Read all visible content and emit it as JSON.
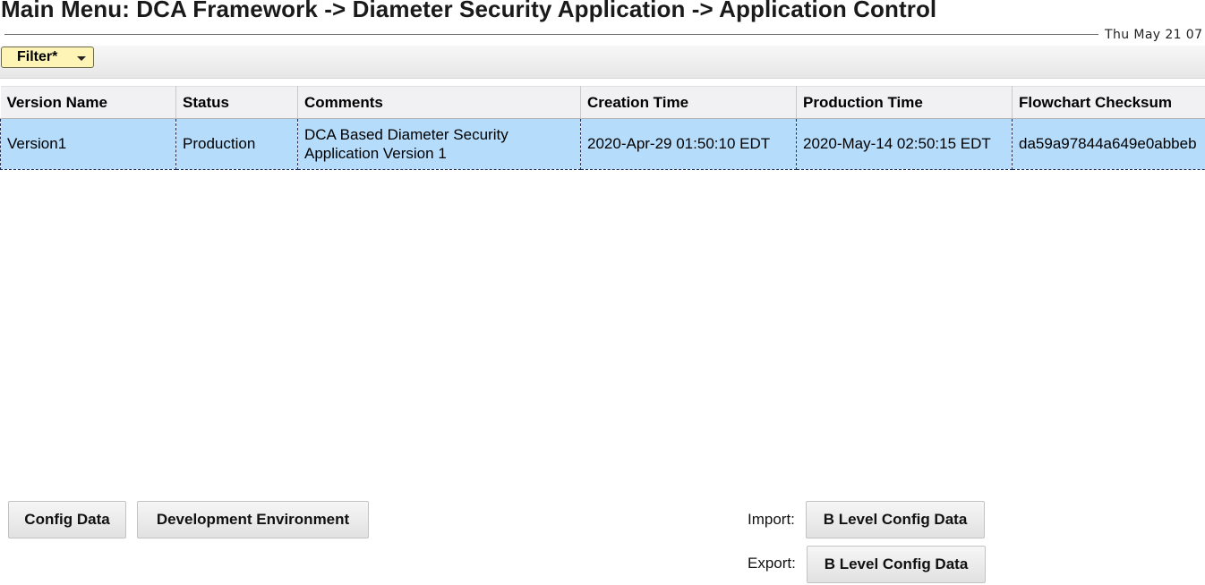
{
  "header": {
    "title": "Main Menu: DCA Framework -> Diameter Security Application -> Application Control",
    "datetime": "Thu May 21 07"
  },
  "filter": {
    "label": "Filter*"
  },
  "table": {
    "columns": [
      "Version Name",
      "Status",
      "Comments",
      "Creation Time",
      "Production Time",
      "Flowchart Checksum"
    ],
    "rows": [
      {
        "version_name": "Version1",
        "status": "Production",
        "comments": "DCA Based Diameter Security Application Version 1",
        "creation_time": "2020-Apr-29 01:50:10 EDT",
        "production_time": "2020-May-14 02:50:15 EDT",
        "flowchart_checksum": "da59a97844a649e0abbeb"
      }
    ]
  },
  "actions": {
    "config_data": "Config Data",
    "development_environment": "Development Environment",
    "import_label": "Import:",
    "import_button": "B Level Config Data",
    "export_label": "Export:",
    "export_button": "B Level Config Data"
  }
}
